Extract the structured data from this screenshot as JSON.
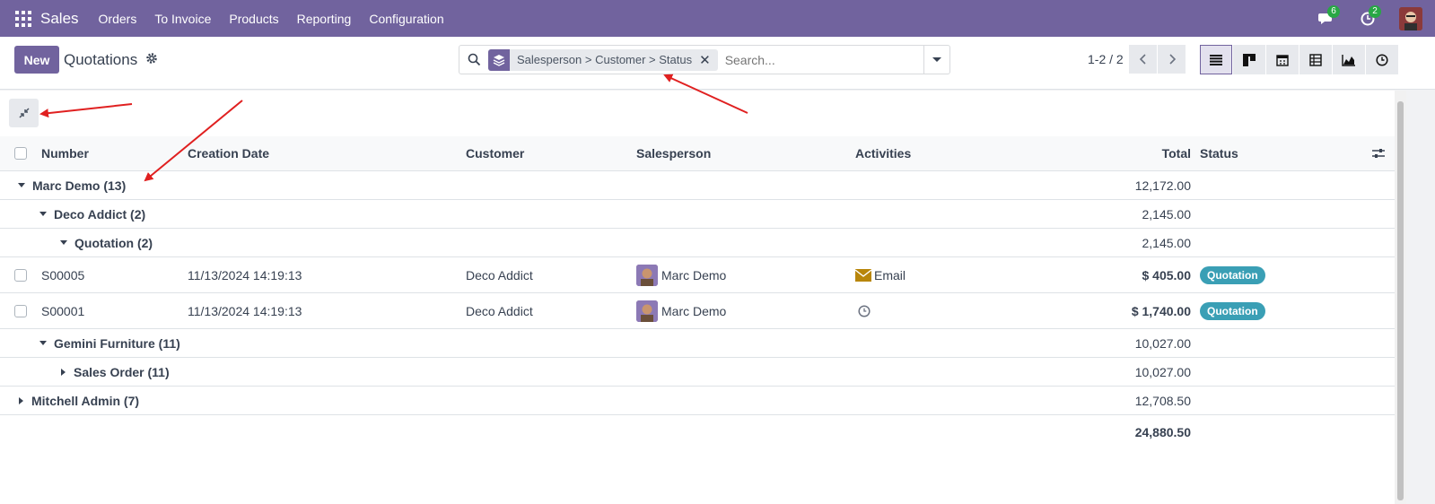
{
  "navbar": {
    "app_name": "Sales",
    "menu": [
      "Orders",
      "To Invoice",
      "Products",
      "Reporting",
      "Configuration"
    ],
    "messages_count": "6",
    "activities_count": "2",
    "bg_color": "#71639e"
  },
  "control_panel": {
    "new_label": "New",
    "title": "Quotations",
    "search": {
      "facet_label": "Salesperson > Customer > Status",
      "placeholder": "Search..."
    },
    "pager": "1-2 / 2",
    "views": [
      "list-icon",
      "kanban-icon",
      "calendar-icon",
      "pivot-icon",
      "graph-icon",
      "activity-icon"
    ]
  },
  "table": {
    "headers": {
      "number": "Number",
      "creation_date": "Creation Date",
      "customer": "Customer",
      "salesperson": "Salesperson",
      "activities": "Activities",
      "total": "Total",
      "status": "Status"
    },
    "groups": [
      {
        "label": "Marc Demo (13)",
        "total": "12,172.00"
      },
      {
        "label": "Deco Addict (2)",
        "total": "2,145.00"
      },
      {
        "label": "Quotation (2)",
        "total": "2,145.00"
      },
      {
        "label": "Gemini Furniture (11)",
        "total": "10,027.00"
      },
      {
        "label": "Sales Order (11)",
        "total": "10,027.00"
      },
      {
        "label": "Mitchell Admin (7)",
        "total": "12,708.50"
      }
    ],
    "records": [
      {
        "number": "S00005",
        "date": "11/13/2024 14:19:13",
        "customer": "Deco Addict",
        "salesperson": "Marc Demo",
        "activity": "Email",
        "total": "$ 405.00",
        "status": "Quotation"
      },
      {
        "number": "S00001",
        "date": "11/13/2024 14:19:13",
        "customer": "Deco Addict",
        "salesperson": "Marc Demo",
        "activity": "",
        "total": "$ 1,740.00",
        "status": "Quotation"
      }
    ],
    "grand_total": "24,880.50"
  }
}
